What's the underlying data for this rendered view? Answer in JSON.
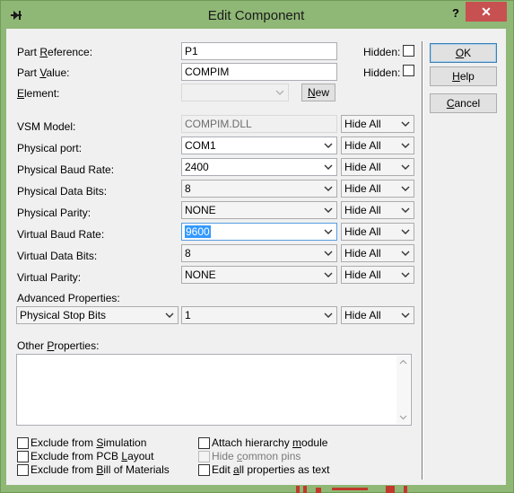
{
  "window": {
    "title": "Edit Component",
    "help_glyph": "?",
    "close_glyph": "✕"
  },
  "fields": {
    "part_reference": {
      "label_pre": "Part ",
      "label_u": "R",
      "label_post": "eference:",
      "value": "P1"
    },
    "part_value": {
      "label_pre": "Part ",
      "label_u": "V",
      "label_post": "alue:",
      "value": "COMPIM"
    },
    "element": {
      "label_pre": "",
      "label_u": "E",
      "label_post": "lement:",
      "value": ""
    },
    "hidden_label": "Hidden:",
    "new_button": {
      "u": "N",
      "rest": "ew"
    }
  },
  "properties": [
    {
      "label": "VSM Model:",
      "value": "COMPIM.DLL",
      "visibility": "Hide All",
      "kind": "text-disabled"
    },
    {
      "label": "Physical port:",
      "value": "COM1",
      "visibility": "Hide All",
      "kind": "combo"
    },
    {
      "label": "Physical Baud Rate:",
      "value": "2400",
      "visibility": "Hide All",
      "kind": "combo"
    },
    {
      "label": "Physical Data Bits:",
      "value": "8",
      "visibility": "Hide All",
      "kind": "combo-ro"
    },
    {
      "label": "Physical Parity:",
      "value": "NONE",
      "visibility": "Hide All",
      "kind": "combo-ro"
    },
    {
      "label": "Virtual Baud Rate:",
      "value": "9600",
      "visibility": "Hide All",
      "kind": "combo-selected"
    },
    {
      "label": "Virtual Data Bits:",
      "value": "8",
      "visibility": "Hide All",
      "kind": "combo-ro"
    },
    {
      "label": "Virtual Parity:",
      "value": "NONE",
      "visibility": "Hide All",
      "kind": "combo-ro"
    }
  ],
  "advanced": {
    "label": "Advanced Properties:",
    "property": "Physical Stop Bits",
    "value": "1",
    "visibility": "Hide All"
  },
  "other_properties": {
    "label_pre": "Other ",
    "label_u": "P",
    "label_post": "roperties:",
    "value": ""
  },
  "checkboxes_left": [
    {
      "pre": "Exclude from ",
      "u": "S",
      "post": "imulation",
      "checked": false,
      "disabled": false
    },
    {
      "pre": "Exclude from PCB ",
      "u": "L",
      "post": "ayout",
      "checked": false,
      "disabled": false
    },
    {
      "pre": "Exclude from ",
      "u": "B",
      "post": "ill of Materials",
      "checked": false,
      "disabled": false
    }
  ],
  "checkboxes_right": [
    {
      "pre": "Attach hierarchy ",
      "u": "m",
      "post": "odule",
      "checked": false,
      "disabled": false
    },
    {
      "pre": "Hide ",
      "u": "c",
      "post": "ommon pins",
      "checked": false,
      "disabled": true
    },
    {
      "pre": "Edit ",
      "u": "a",
      "post": "ll properties as text",
      "checked": false,
      "disabled": false
    }
  ],
  "buttons": {
    "ok": {
      "u": "O",
      "rest": "K"
    },
    "help": {
      "u": "H",
      "rest": "elp"
    },
    "cancel": {
      "u": "C",
      "rest": "ancel"
    }
  },
  "colors": {
    "title_bar": "#8fb776",
    "close_button": "#c75050",
    "selection": "#3399ff"
  }
}
